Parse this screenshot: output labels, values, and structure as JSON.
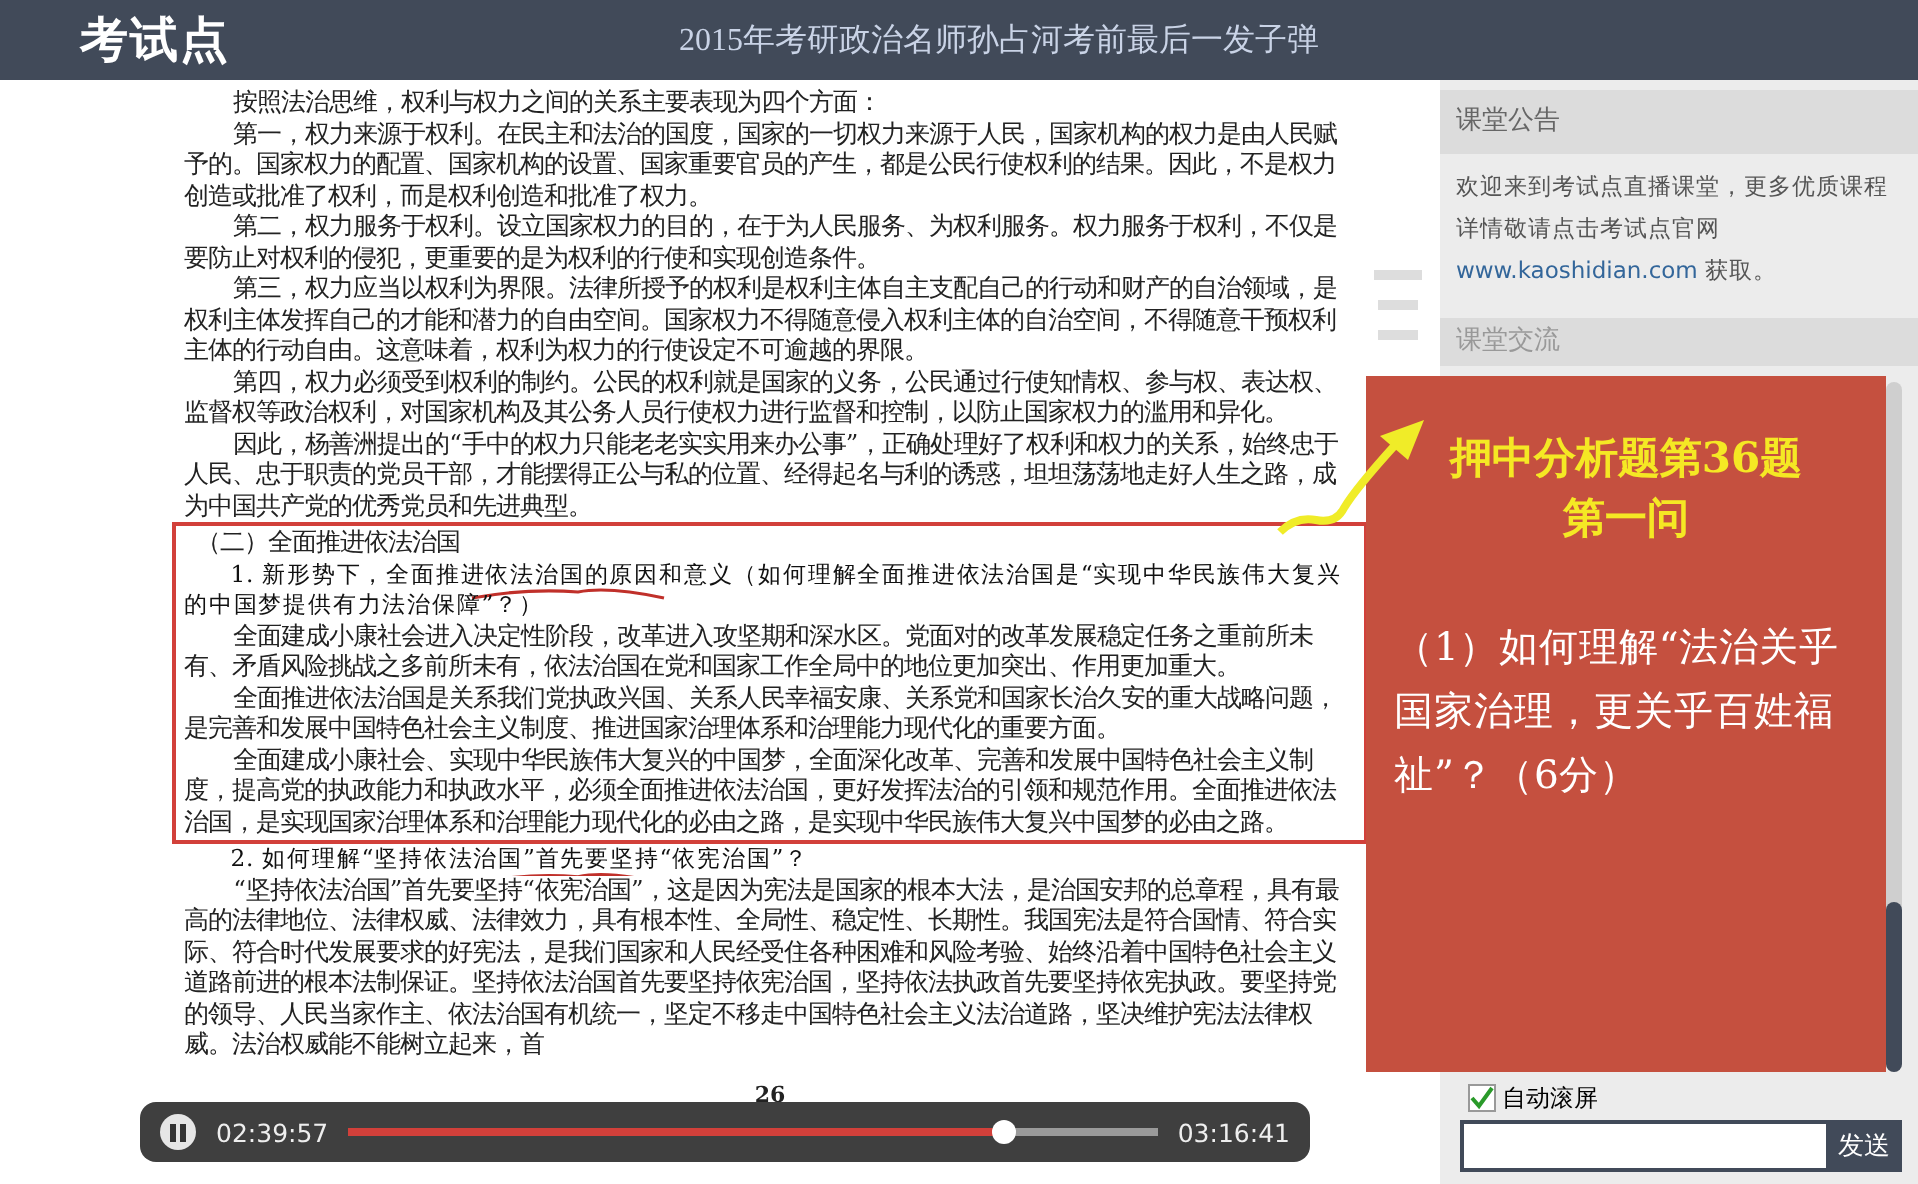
{
  "header": {
    "logo": "考试点",
    "title": "2015年考研政治名师孙占河考前最后一发子弹"
  },
  "document": {
    "paragraphs": [
      {
        "kind": "plain",
        "text": "按照法治思维，权利与权力之间的关系主要表现为四个方面："
      },
      {
        "kind": "plain",
        "text": "第一，权力来源于权利。在民主和法治的国度，国家的一切权力来源于人民，国家机构的权力是由人民赋予的。国家权力的配置、国家机构的设置、国家重要官员的产生，都是公民行使权利的结果。因此，不是权力创造或批准了权利，而是权利创造和批准了权力。"
      },
      {
        "kind": "plain",
        "text": "第二，权力服务于权利。设立国家权力的目的，在于为人民服务、为权利服务。权力服务于权利，不仅是要防止对权利的侵犯，更重要的是为权利的行使和实现创造条件。"
      },
      {
        "kind": "plain",
        "text": "第三，权力应当以权利为界限。法律所授予的权利是权利主体自主支配自己的行动和财产的自治领域，是权利主体发挥自己的才能和潜力的自由空间。国家权力不得随意侵入权利主体的自治空间，不得随意干预权利主体的行动自由。这意味着，权利为权力的行使设定不可逾越的界限。"
      },
      {
        "kind": "plain",
        "text": "第四，权力必须受到权利的制约。公民的权利就是国家的义务，公民通过行使知情权、参与权、表达权、监督权等政治权利，对国家机构及其公务人员行使权力进行监督和控制，以防止国家权力的滥用和异化。"
      },
      {
        "kind": "plain",
        "text": "因此，杨善洲提出的“手中的权力只能老老实实用来办公事”，正确处理好了权利和权力的关系，始终忠于人民、忠于职责的党员干部，才能摆得正公与私的位置、经得起名与利的诱惑，坦坦荡荡地走好人生之路，成为中国共产党的优秀党员和先进典型。"
      }
    ],
    "boxed": [
      {
        "kind": "heading",
        "text": "（二）全面推进依法治国"
      },
      {
        "kind": "question",
        "text": "1. 新形势下，全面推进依法治国的原因和意义（如何理解全面推进依法治国是“实现中华民族伟大复兴的中国梦提供有力法治保障”？）"
      },
      {
        "kind": "plain",
        "text": "全面建成小康社会进入决定性阶段，改革进入攻坚期和深水区。党面对的改革发展稳定任务之重前所未有、矛盾风险挑战之多前所未有，依法治国在党和国家工作全局中的地位更加突出、作用更加重大。"
      },
      {
        "kind": "plain",
        "text": "全面推进依法治国是关系我们党执政兴国、关系人民幸福安康、关系党和国家长治久安的重大战略问题，是完善和发展中国特色社会主义制度、推进国家治理体系和治理能力现代化的重要方面。"
      },
      {
        "kind": "plain",
        "text": "全面建成小康社会、实现中华民族伟大复兴的中国梦，全面深化改革、完善和发展中国特色社会主义制度，提高党的执政能力和执政水平，必须全面推进依法治国，更好发挥法治的引领和规范作用。全面推进依法治国，是实现国家治理体系和治理能力现代化的必由之路，是实现中华民族伟大复兴中国梦的必由之路。"
      }
    ],
    "after": [
      {
        "kind": "question",
        "text": "2. 如何理解“坚持依法治国”首先要坚持“依宪治国”？"
      },
      {
        "kind": "plain",
        "text": "“坚持依法治国”首先要坚持“依宪治国”，这是因为宪法是国家的根本大法，是治国安邦的总章程，具有最高的法律地位、法律权威、法律效力，具有根本性、全局性、稳定性、长期性。我国宪法是符合国情、符合实际、符合时代发展要求的好宪法，是我们国家和人民经受住各种困难和风险考验、始终沿着中国特色社会主义道路前进的根本法制保证。坚持依法治国首先要坚持依宪治国，坚持依法执政首先要坚持依宪执政。要坚持党的领导、人民当家作主、依法治国有机统一，坚定不移走中国特色社会主义法治道路，坚决维护宪法法律权威。法治权威能不能树立起来，首"
      }
    ],
    "page_number": "26"
  },
  "player": {
    "playing": true,
    "elapsed": "02:39:57",
    "duration": "03:16:41",
    "level": 0.81
  },
  "announcement": {
    "title": "课堂公告",
    "text": "欢迎来到考试点直播课堂，更多优质课程详情敬请点击考试点官网",
    "link": "www.kaoshidian.com",
    "suffix": " 获取。"
  },
  "chat": {
    "title": "课堂交流",
    "auto_scroll": {
      "label": "自动滚屏",
      "checked": true
    },
    "send": "发送"
  },
  "overlay": {
    "title_lines": [
      "押中分析题第36题",
      "第一问"
    ],
    "question": "（1）如何理解“法治关乎国家治理，更关乎百姓福祉”？（6分）"
  }
}
